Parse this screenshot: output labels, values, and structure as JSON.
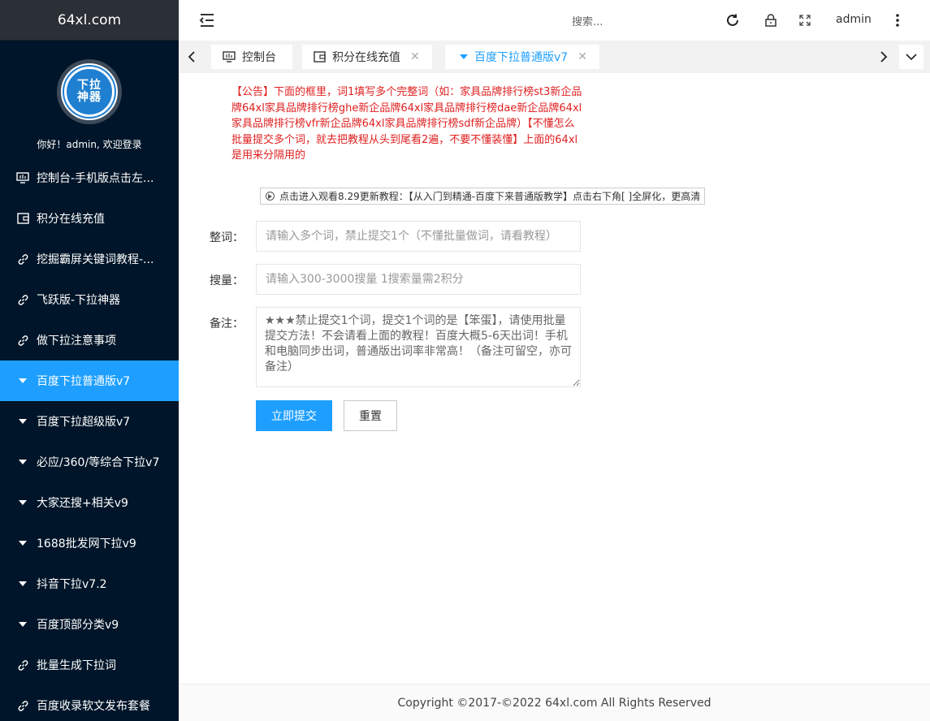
{
  "sidebar": {
    "logo": "64xl.com",
    "avatar_lines": [
      "下拉",
      "神器"
    ],
    "welcome": "你好！admin, 欢迎登录",
    "items": [
      {
        "label": "控制台-手机版点击左...",
        "icon": "monitor-icon"
      },
      {
        "label": "积分在线充值",
        "icon": "recharge-icon"
      },
      {
        "label": "挖掘霸屏关键词教程-...",
        "icon": "link-icon"
      },
      {
        "label": "飞跃版-下拉神器",
        "icon": "link-icon"
      },
      {
        "label": "做下拉注意事项",
        "icon": "link-icon"
      },
      {
        "label": "百度下拉普通版v7",
        "icon": "caret-down-icon"
      },
      {
        "label": "百度下拉超级版v7",
        "icon": "caret-down-icon"
      },
      {
        "label": "必应/360/等综合下拉v7",
        "icon": "caret-down-icon"
      },
      {
        "label": "大家还搜+相关v9",
        "icon": "caret-down-icon"
      },
      {
        "label": "1688批发网下拉v9",
        "icon": "caret-down-icon"
      },
      {
        "label": "抖音下拉v7.2",
        "icon": "caret-down-icon"
      },
      {
        "label": "百度顶部分类v9",
        "icon": "caret-down-icon"
      },
      {
        "label": "批量生成下拉词",
        "icon": "link-icon"
      },
      {
        "label": "百度收录软文发布套餐",
        "icon": "link-icon"
      }
    ],
    "active_index": 5
  },
  "header": {
    "search_placeholder": "搜索...",
    "user": "admin"
  },
  "tabs": [
    {
      "label": "控制台",
      "icon": "monitor-icon",
      "closable": false
    },
    {
      "label": "积分在线充值",
      "icon": "recharge-icon",
      "closable": true
    },
    {
      "label": "百度下拉普通版v7",
      "icon": "caret-down-icon",
      "closable": true
    }
  ],
  "tab_close_glyph": "✕",
  "main": {
    "notice": "【公告】下面的框里，词1填写多个完整词（如：家具品牌排行榜st3新企品牌64xl家具品牌排行榜ghe新企品牌64xl家具品牌排行榜dae新企品牌64xl家具品牌排行榜vfr新企品牌64xl家具品牌排行榜sdf新企品牌）【不懂怎么批量提交多个词，就去把教程从头到尾看2遍，不要不懂装懂】上面的64xl是用来分隔用的",
    "video_link": "点击进入观看8.29更新教程：【从入门到精通-百度下来普通版教学】点击右下角[ ]全屏化，更高清",
    "form": {
      "words_label": "整词：",
      "words_placeholder": "请输入多个词，禁止提交1个（不懂批量做词，请看教程）",
      "volume_label": "搜量：",
      "volume_placeholder": "请输入300-3000搜量 1搜索量需2积分",
      "remark_label": "备注：",
      "remark_value": "★★★禁止提交1个词，提交1个词的是【笨蛋】，请使用批量提交方法！不会请看上面的教程！百度大概5-6天出词！手机和电脑同步出词，普通版出词率非常高！（备注可留空，亦可备注）",
      "submit_label": "立即提交",
      "reset_label": "重置"
    }
  },
  "footer": {
    "copyright": "Copyright ©2017-©2022 64xl.com All Rights Reserved"
  },
  "colors": {
    "sidebar_bg": "#001529",
    "accent": "#1e9fff",
    "notice_red": "#e02020"
  }
}
